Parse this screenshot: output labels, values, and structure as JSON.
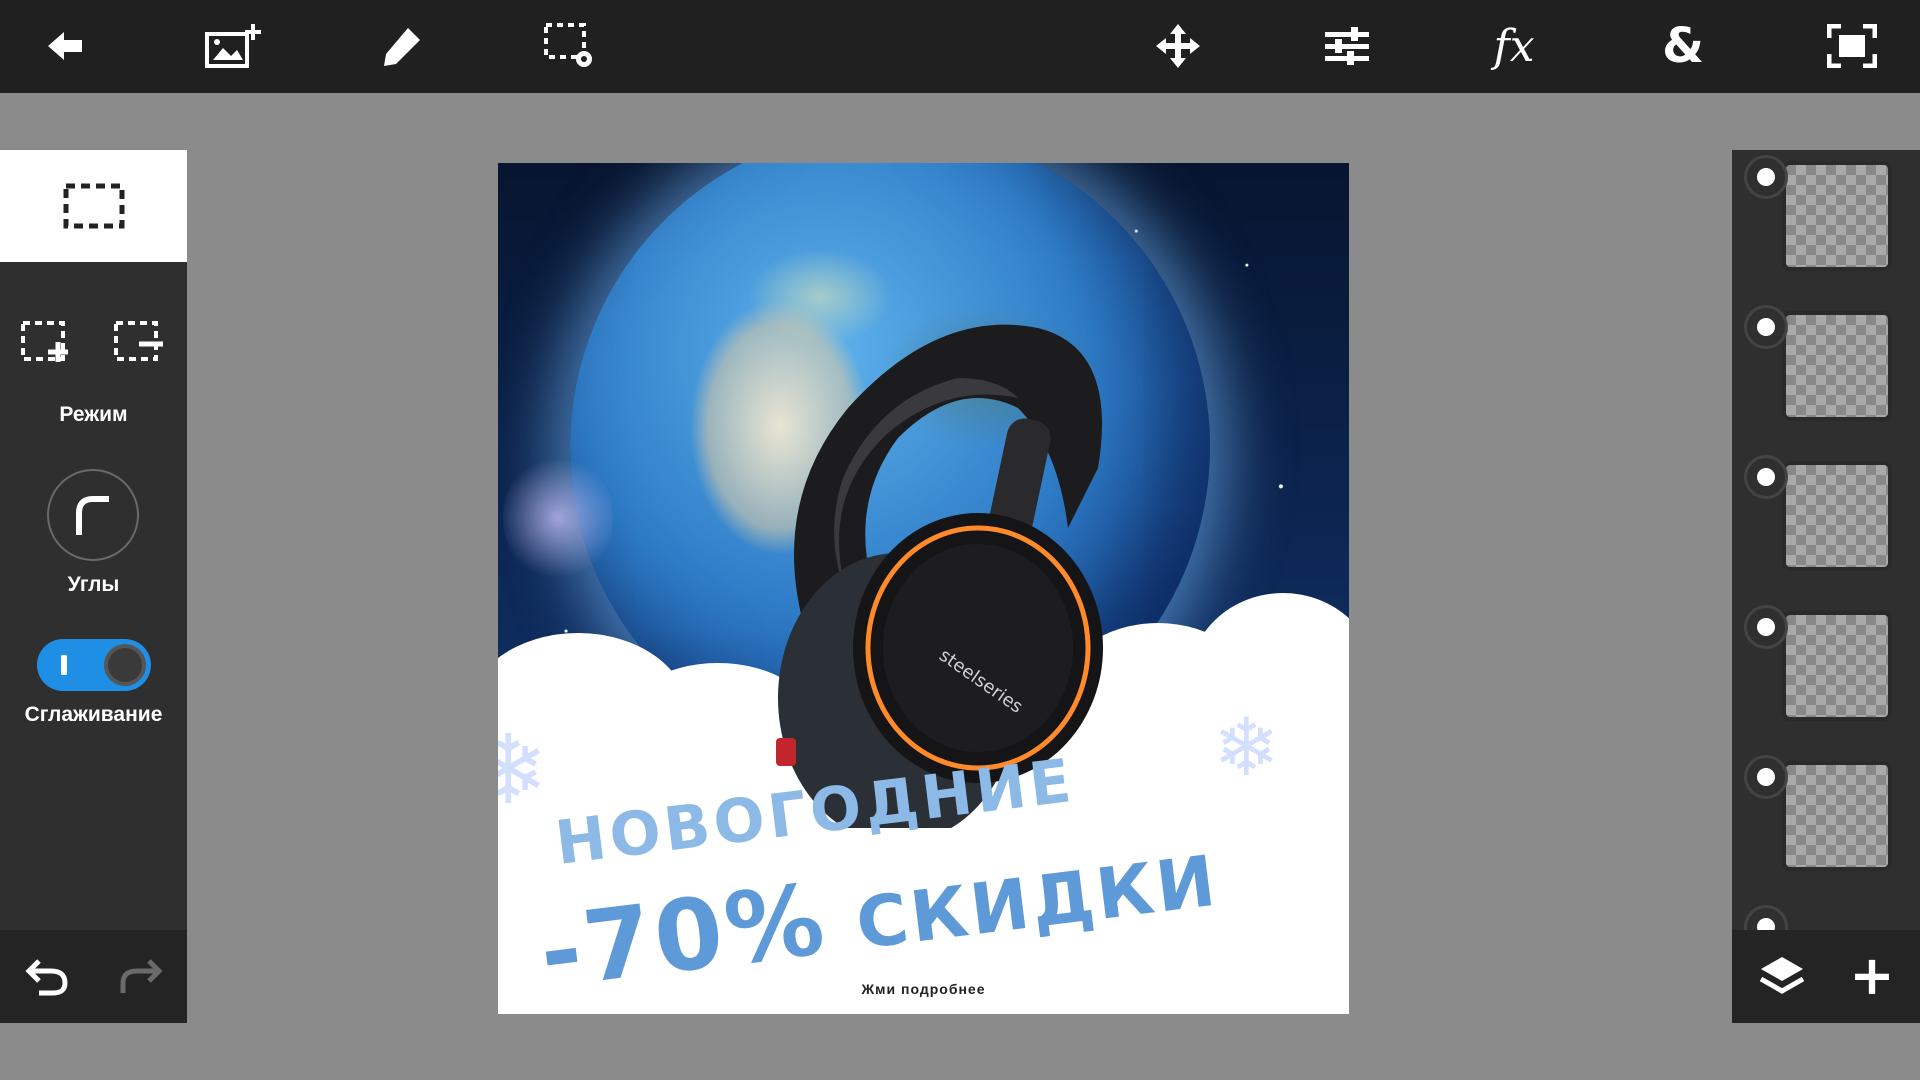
{
  "toolbar": {
    "icons": [
      "back-arrow-icon",
      "add-image-icon",
      "brush-icon",
      "selection-settings-icon",
      "move-icon",
      "adjustments-icon",
      "fx-icon",
      "blend-icon",
      "fullscreen-icon"
    ],
    "fx_label": "fx",
    "blend_label": "&"
  },
  "left_panel": {
    "mode_label": "Режим",
    "corners_label": "Углы",
    "antialias_label": "Сглаживание",
    "antialias_on": true
  },
  "canvas": {
    "headline_1": "НОВОГОДНИЕ",
    "headline_2_discount": "-70%",
    "headline_2_word": "СКИДКИ",
    "brand": "steelseries",
    "cta": "Жми подробнее"
  },
  "right_panel": {
    "layer_count_visible": 6,
    "layers": [
      {
        "id": "layer-1"
      },
      {
        "id": "layer-2"
      },
      {
        "id": "layer-3"
      },
      {
        "id": "layer-4"
      },
      {
        "id": "layer-5"
      }
    ],
    "add_label": "+"
  },
  "colors": {
    "toolbar_bg": "#202020",
    "panel_bg": "#2f2f2f",
    "workspace_bg": "#8b8b8b",
    "accent": "#1f8fe6"
  }
}
